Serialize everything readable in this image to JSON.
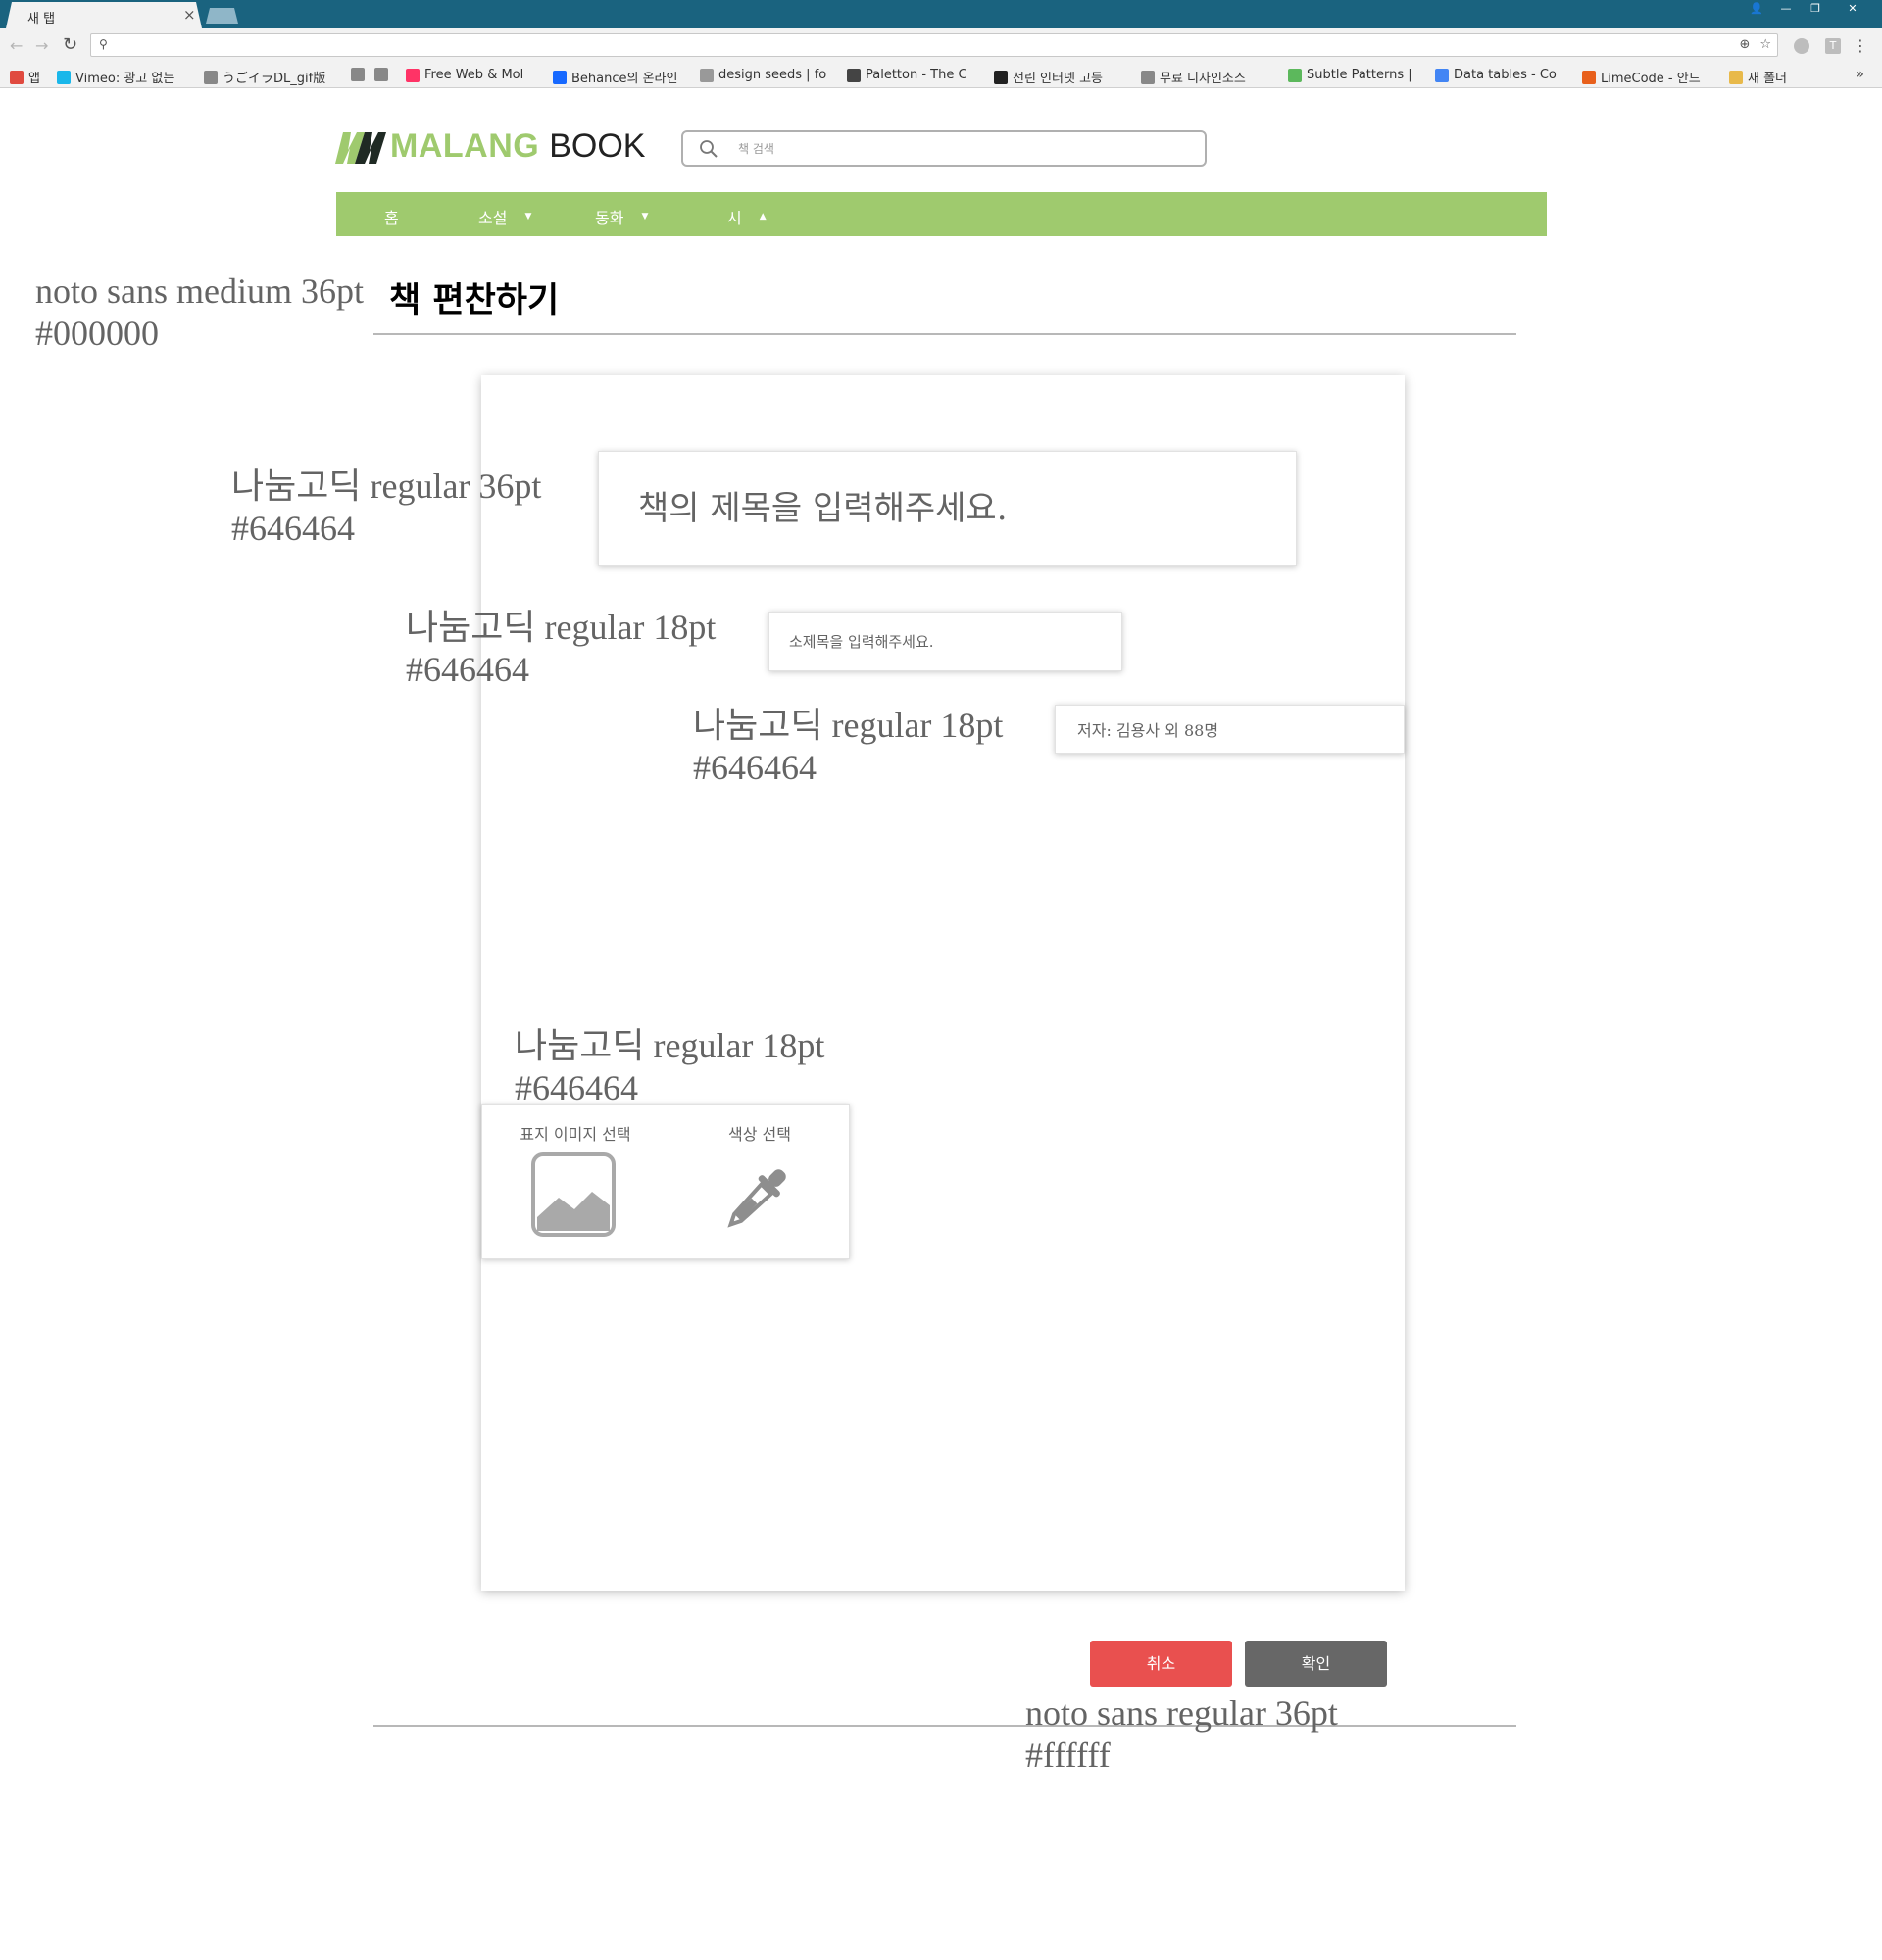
{
  "browser": {
    "tab_title": "새 탭",
    "tab_close": "×",
    "window_controls": [
      "👤",
      "—",
      "❐",
      "✕"
    ],
    "bookmarks": [
      {
        "label": "앱",
        "icon": "apps-grid-icon",
        "color": "#e04a3f"
      },
      {
        "label": "Vimeo: 광고 없는",
        "icon": "vimeo-icon",
        "color": "#1ab7ea"
      },
      {
        "label": "うごイラDL_gif版",
        "icon": "page-icon",
        "color": "#888888"
      },
      {
        "label": "",
        "icon": "page-icon",
        "color": "#888888"
      },
      {
        "label": "",
        "icon": "page-icon",
        "color": "#888888"
      },
      {
        "label": "Free Web & Mol",
        "icon": "invision-icon",
        "color": "#ff3366"
      },
      {
        "label": "Behance의 온라인",
        "icon": "behance-icon",
        "color": "#1769ff"
      },
      {
        "label": "design seeds | fo",
        "icon": "design-seeds-icon",
        "color": "#999999"
      },
      {
        "label": "Paletton - The C",
        "icon": "paletton-icon",
        "color": "#444444"
      },
      {
        "label": "선린 인터넷 고등",
        "icon": "school-icon",
        "color": "#222222"
      },
      {
        "label": "무료 디자인소스",
        "icon": "page-icon",
        "color": "#888888"
      },
      {
        "label": "Subtle Patterns |",
        "icon": "subtle-patterns-icon",
        "color": "#5cb85c"
      },
      {
        "label": "Data tables - Co",
        "icon": "google-icon",
        "color": "#4285f4"
      },
      {
        "label": "LimeCode - 안드",
        "icon": "limecode-icon",
        "color": "#e8601c"
      },
      {
        "label": "새 폴더",
        "icon": "folder-icon",
        "color": "#e8b94a"
      }
    ],
    "bookmarks_more": "»"
  },
  "header": {
    "logo_primary": "MALANG",
    "logo_secondary": "BOOK",
    "search_placeholder": "책 검색"
  },
  "nav": {
    "items": [
      {
        "label": "홈",
        "caret": ""
      },
      {
        "label": "소설",
        "caret": "▼"
      },
      {
        "label": "동화",
        "caret": "▼"
      },
      {
        "label": "시",
        "caret": "▲"
      }
    ]
  },
  "page": {
    "title": "책 편찬하기"
  },
  "form": {
    "title_placeholder": "책의 제목을 입력해주세요.",
    "subtitle_placeholder": "소제목을 입력해주세요.",
    "author_value": "저자: 김용사 외 88명",
    "cover_image_label": "표지 이미지 선택",
    "color_label": "색상 선택",
    "cancel_label": "취소",
    "confirm_label": "확인"
  },
  "annotations": {
    "title_spec": [
      "noto sans medium 36pt",
      "#000000"
    ],
    "book_title_spec": [
      "나눔고딕 regular 36pt",
      "#646464"
    ],
    "subtitle_spec": [
      "나눔고딕 regular 18pt",
      "#646464"
    ],
    "author_spec": [
      "나눔고딕 regular 18pt",
      "#646464"
    ],
    "picker_spec": [
      "나눔고딕 regular 18pt",
      "#646464"
    ],
    "button_spec": [
      "noto sans regular 36pt",
      "#ffffff"
    ]
  },
  "colors": {
    "brand_green": "#9fca6e",
    "tab_bar": "#1a637f",
    "cancel_red": "#e9504f",
    "confirm_gray": "#676767",
    "text_gray": "#646464"
  }
}
